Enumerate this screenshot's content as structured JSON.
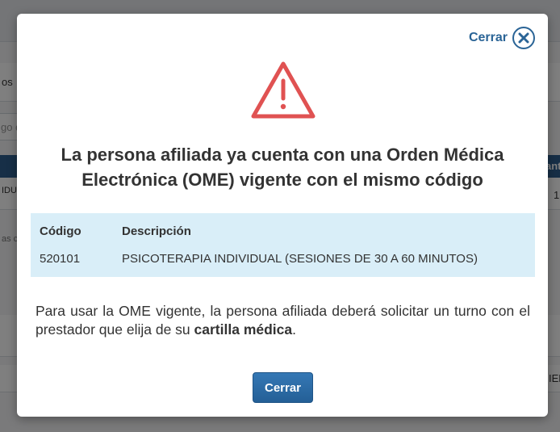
{
  "background": {
    "fragments": [
      "os",
      "go d",
      "IDU",
      "as c",
      "ant",
      "1",
      "IEN"
    ]
  },
  "modal": {
    "close_link_label": "Cerrar",
    "icons": {
      "close": "close-circle-icon",
      "warning": "warning-triangle-icon"
    },
    "title_line1": "La persona afiliada ya cuenta con una Orden Médica",
    "title_line2": "Electrónica (OME) vigente con el mismo código",
    "table": {
      "headers": [
        "Código",
        "Descripción"
      ],
      "rows": [
        [
          "520101",
          "PSICOTERAPIA INDIVIDUAL (SESIONES DE 30 A 60 MINUTOS)"
        ]
      ]
    },
    "message_part1": "Para usar la OME vigente, la persona afiliada deberá solicitar un turno con el prestador que elija de su ",
    "message_bold": "cartilla médica",
    "message_part2": ".",
    "button_label": "Cerrar",
    "colors": {
      "accent": "#2a6496",
      "warning": "#e05252",
      "table_bg": "#d9eef8"
    }
  }
}
